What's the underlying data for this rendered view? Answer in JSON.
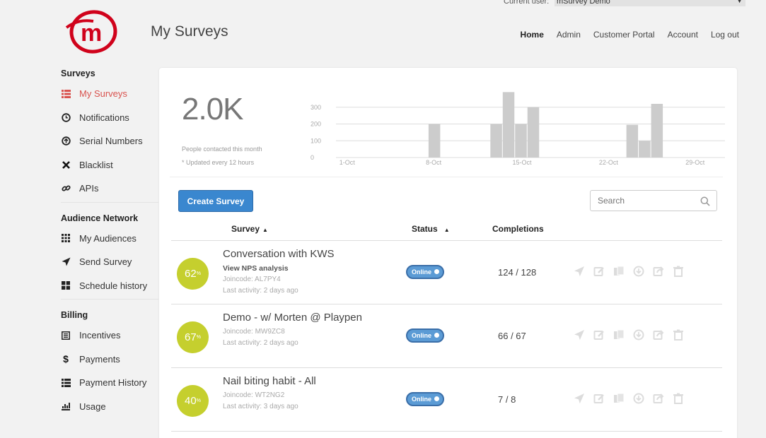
{
  "current_user": {
    "label": "Current user:",
    "value": "mSurvey Demo"
  },
  "page_title": "My Surveys",
  "topnav": [
    "Home",
    "Admin",
    "Customer Portal",
    "Account",
    "Log out"
  ],
  "sidebar": {
    "sections": [
      {
        "heading": "Surveys",
        "items": [
          {
            "label": "My Surveys",
            "icon": "list-icon",
            "active": true
          },
          {
            "label": "Notifications",
            "icon": "clock-icon"
          },
          {
            "label": "Serial Numbers",
            "icon": "upload-circle-icon"
          },
          {
            "label": "Blacklist",
            "icon": "close-icon"
          },
          {
            "label": "APIs",
            "icon": "link-icon"
          }
        ]
      },
      {
        "heading": "Audience Network",
        "items": [
          {
            "label": "My Audiences",
            "icon": "grid-icon"
          },
          {
            "label": "Send Survey",
            "icon": "send-icon"
          },
          {
            "label": "Schedule history",
            "icon": "blocks-icon"
          }
        ]
      },
      {
        "heading": "Billing",
        "items": [
          {
            "label": "Incentives",
            "icon": "list-alt-icon"
          },
          {
            "label": "Payments",
            "icon": "dollar-icon"
          },
          {
            "label": "Payment History",
            "icon": "list-icon"
          },
          {
            "label": "Usage",
            "icon": "bar-chart-icon"
          }
        ]
      }
    ]
  },
  "stats": {
    "big_number": "2.0K",
    "caption": "People contacted this month",
    "note": "* Updated every 12 hours"
  },
  "chart_data": {
    "type": "bar",
    "y_ticks": [
      "0",
      "100",
      "200",
      "300"
    ],
    "x_ticks": [
      "1-Oct",
      "8-Oct",
      "15-Oct",
      "22-Oct",
      "29-Oct"
    ],
    "ylim": [
      0,
      400
    ],
    "bars": [
      {
        "day": 8,
        "value": 200
      },
      {
        "day": 13,
        "value": 200
      },
      {
        "day": 14,
        "value": 390
      },
      {
        "day": 15,
        "value": 200
      },
      {
        "day": 16,
        "value": 300
      },
      {
        "day": 24,
        "value": 195
      },
      {
        "day": 25,
        "value": 100
      },
      {
        "day": 26,
        "value": 320
      }
    ],
    "grid": true
  },
  "toolbar": {
    "create_label": "Create Survey",
    "search_placeholder": "Search"
  },
  "table": {
    "headers": {
      "survey": "Survey",
      "status": "Status",
      "completions": "Completions"
    },
    "rows": [
      {
        "percent": "62",
        "name": "Conversation with KWS",
        "link": "View NPS analysis",
        "joincode": "Joincode: AL7PY4",
        "activity": "Last activity: 2 days ago",
        "status": "Online",
        "completions": "124 / 128"
      },
      {
        "percent": "67",
        "name": "Demo - w/ Morten @ Playpen",
        "link": "",
        "joincode": "Joincode: MW9ZC8",
        "activity": "Last activity: 2 days ago",
        "status": "Online",
        "completions": "66 / 67"
      },
      {
        "percent": "40",
        "name": "Nail biting habit - All",
        "link": "",
        "joincode": "Joincode: WT2NG2",
        "activity": "Last activity: 3 days ago",
        "status": "Online",
        "completions": "7 / 8"
      }
    ]
  },
  "row_actions": [
    "send-icon",
    "edit-icon",
    "copy-icon",
    "download-icon",
    "share-icon",
    "trash-icon"
  ],
  "colors": {
    "brand_red": "#d9534f",
    "primary_blue": "#3a87cf",
    "percent_green": "#c5cf2e"
  }
}
